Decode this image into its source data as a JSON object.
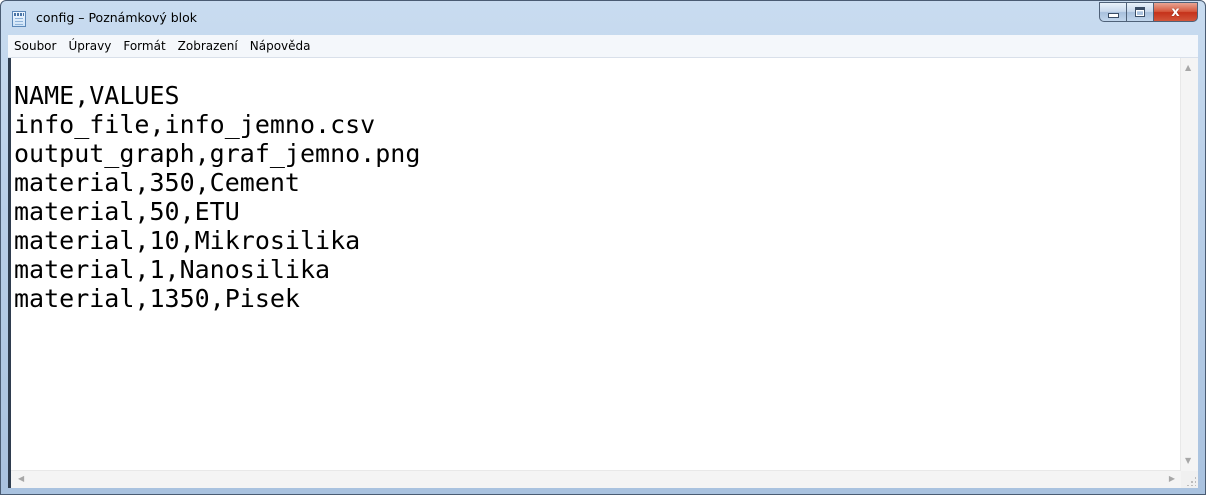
{
  "window": {
    "title": "config – Poznámkový blok",
    "icon": "notepad-icon",
    "buttons": {
      "minimize_icon": "minimize-icon",
      "maximize_icon": "maximize-icon",
      "close_icon": "close-icon",
      "close_glyph": "x"
    }
  },
  "menu": {
    "items": [
      {
        "label": "Soubor"
      },
      {
        "label": "Úpravy"
      },
      {
        "label": "Formát"
      },
      {
        "label": "Zobrazení"
      },
      {
        "label": "Nápověda"
      }
    ]
  },
  "document": {
    "lines": [
      "NAME,VALUES",
      "info_file,info_jemno.csv",
      "output_graph,graf_jemno.png",
      "material,350,Cement",
      "material,50,ETU",
      "material,10,Mikrosilika",
      "material,1,Nanosilika",
      "material,1350,Pisek"
    ]
  },
  "scrollbars": {
    "up_arrow": "▲",
    "down_arrow": "▼",
    "left_arrow": "◀",
    "right_arrow": "▶"
  },
  "colors": {
    "titlebar": "#b9cfe8",
    "close_button": "#c5311a",
    "editor_background": "#ffffff"
  }
}
